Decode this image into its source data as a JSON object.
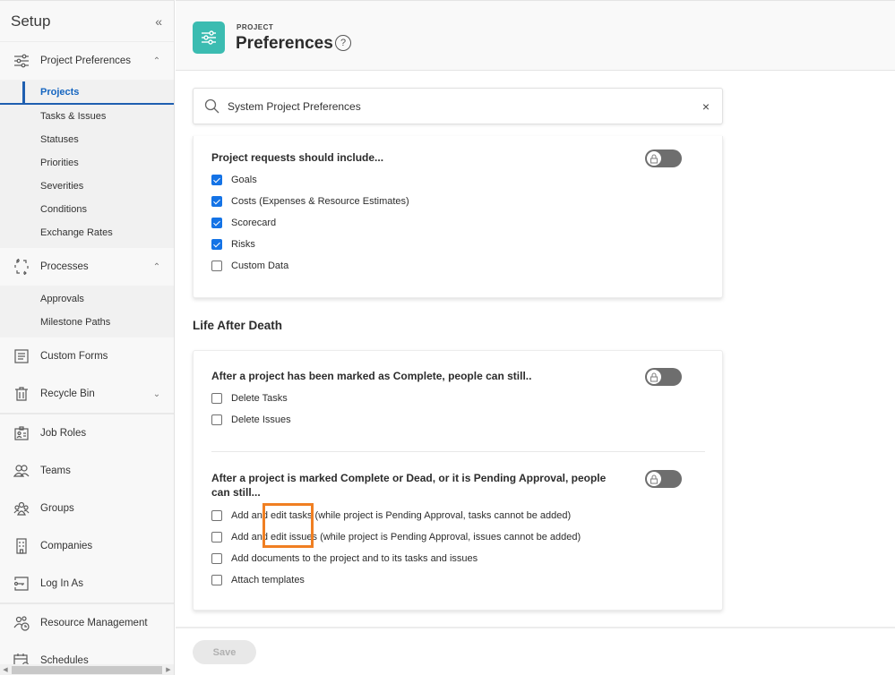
{
  "sidebar": {
    "title": "Setup",
    "collapse_glyph": "«",
    "groups": [
      {
        "label": "Project Preferences",
        "icon": "sliders-icon",
        "expanded": true,
        "chevron": "^",
        "items": [
          {
            "label": "Projects",
            "active": true
          },
          {
            "label": "Tasks & Issues"
          },
          {
            "label": "Statuses"
          },
          {
            "label": "Priorities"
          },
          {
            "label": "Severities"
          },
          {
            "label": "Conditions"
          },
          {
            "label": "Exchange Rates"
          }
        ]
      },
      {
        "label": "Processes",
        "icon": "processes-icon",
        "expanded": true,
        "chevron": "^",
        "items": [
          {
            "label": "Approvals"
          },
          {
            "label": "Milestone Paths"
          }
        ]
      }
    ],
    "items": [
      {
        "label": "Custom Forms",
        "icon": "custom-forms-icon"
      },
      {
        "label": "Recycle Bin",
        "icon": "trash-icon",
        "chevron": "v"
      },
      {
        "label": "Job Roles",
        "icon": "job-roles-icon"
      },
      {
        "label": "Teams",
        "icon": "teams-icon"
      },
      {
        "label": "Groups",
        "icon": "groups-icon"
      },
      {
        "label": "Companies",
        "icon": "building-icon"
      },
      {
        "label": "Log In As",
        "icon": "key-icon"
      },
      {
        "label": "Resource Management",
        "icon": "resource-management-icon"
      },
      {
        "label": "Schedules",
        "icon": "calendar-icon"
      }
    ]
  },
  "header": {
    "kicker": "PROJECT",
    "title": "Preferences",
    "help_glyph": "?",
    "accent_color": "#3bbcb1"
  },
  "search": {
    "value": "System Project Preferences",
    "placeholder": "Search",
    "clear_glyph": "×"
  },
  "card1": {
    "title": "Project requests should include...",
    "locked": true,
    "options": [
      {
        "label": "Goals",
        "checked": true
      },
      {
        "label": "Costs (Expenses & Resource Estimates)",
        "checked": true
      },
      {
        "label": "Scorecard",
        "checked": true
      },
      {
        "label": "Risks",
        "checked": true
      },
      {
        "label": "Custom Data",
        "checked": false
      }
    ]
  },
  "section": {
    "title": "Life After Death"
  },
  "card2": {
    "group1": {
      "title": "After a project has been marked as Complete, people can still..",
      "locked": true,
      "options": [
        {
          "label": "Delete Tasks",
          "checked": false
        },
        {
          "label": "Delete Issues",
          "checked": false
        }
      ]
    },
    "group2": {
      "title": "After a project is marked Complete or Dead, or it is Pending Approval, people can still...",
      "locked": true,
      "options": [
        {
          "label": "Add and edit tasks (while project is Pending Approval, tasks cannot be added)",
          "checked": false
        },
        {
          "label": "Add and edit issues (while project is Pending Approval, issues cannot be added)",
          "checked": false
        },
        {
          "label": "Add documents to the project and to its tasks and issues",
          "checked": false
        },
        {
          "label": "Attach templates",
          "checked": false
        }
      ]
    }
  },
  "annotation": {
    "highlight_color": "#f07f22"
  },
  "footer": {
    "save_label": "Save",
    "save_enabled": false
  }
}
